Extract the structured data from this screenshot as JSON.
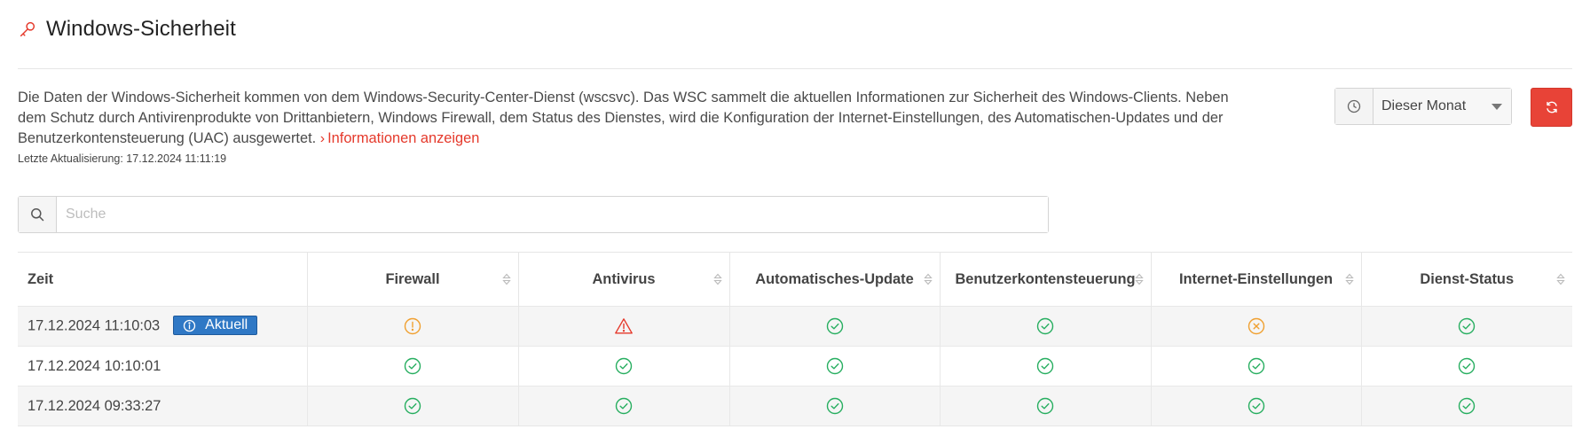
{
  "header": {
    "title": "Windows-Sicherheit",
    "icon": "key-icon",
    "icon_color": "#e5392b"
  },
  "description": {
    "text": "Die Daten der Windows-Sicherheit kommen von dem Windows-Security-Center-Dienst (wscsvc). Das WSC sammelt die aktuellen Informationen zur Sicherheit des Windows-Clients. Neben dem Schutz durch Antivirenprodukte von Drittanbietern, Windows Firewall, dem Status des Dienstes, wird die Konfiguration der Internet-Einstellungen, des Automatischen-Updates und der Benutzerkontensteuerung (UAC) ausgewertet.",
    "link_label": "Informationen anzeigen",
    "last_update": "Letzte Aktualisierung: 17.12.2024 11:11:19"
  },
  "controls": {
    "period_selected": "Dieser Monat",
    "period_icon": "clock-icon",
    "refresh_icon": "refresh-icon",
    "refresh_color": "#e84337"
  },
  "search": {
    "placeholder": "Suche",
    "value": ""
  },
  "table": {
    "columns": [
      "Zeit",
      "Firewall",
      "Antivirus",
      "Automatisches-Update",
      "Benutzerkontensteuerung",
      "Internet-Einstellungen",
      "Dienst-Status"
    ],
    "current_badge": "Aktuell",
    "rows": [
      {
        "time": "17.12.2024 11:10:03",
        "current": true,
        "statuses": [
          "warning",
          "alert",
          "ok",
          "ok",
          "error",
          "ok"
        ]
      },
      {
        "time": "17.12.2024 10:10:01",
        "current": false,
        "statuses": [
          "ok",
          "ok",
          "ok",
          "ok",
          "ok",
          "ok"
        ]
      },
      {
        "time": "17.12.2024 09:33:27",
        "current": false,
        "statuses": [
          "ok",
          "ok",
          "ok",
          "ok",
          "ok",
          "ok"
        ]
      }
    ]
  },
  "colors": {
    "ok": "#27ae60",
    "warning": "#f0a030",
    "alert": "#e5392b",
    "error": "#f0a030",
    "badge": "#2f78c5"
  }
}
